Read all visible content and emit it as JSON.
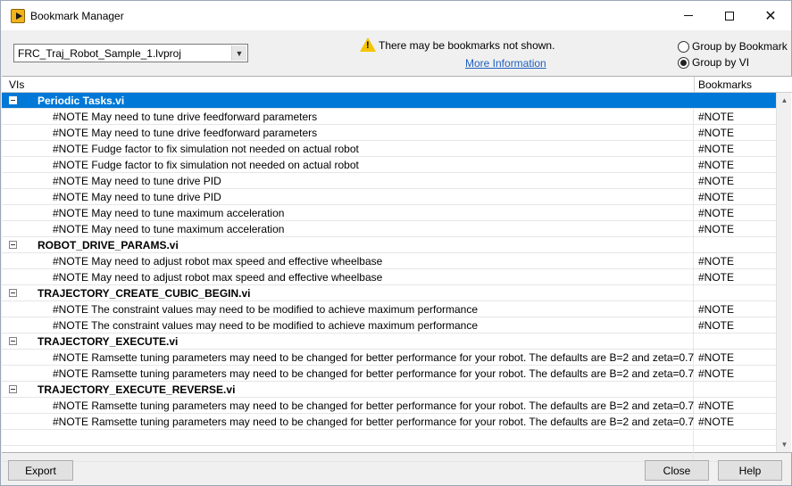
{
  "window": {
    "title": "Bookmark Manager",
    "minimize_label": "",
    "maximize_label": "",
    "close_label": "✕"
  },
  "toolbar": {
    "project": "FRC_Traj_Robot_Sample_1.lvproj",
    "dropdown_arrow": "▼",
    "warning_text": "There may be bookmarks not shown.",
    "more_info": "More Information",
    "group_by_bookmark": "Group by Bookmark",
    "group_by_vi": "Group by VI",
    "selected_grouping": "Group by VI"
  },
  "table": {
    "col_vis": "VIs",
    "col_bookmarks": "Bookmarks",
    "groups": [
      {
        "name": "Periodic Tasks.vi",
        "selected": true,
        "items": [
          {
            "text": "#NOTE  May need to tune drive feedforward parameters",
            "bookmark": "#NOTE"
          },
          {
            "text": "#NOTE  May need to tune drive feedforward parameters",
            "bookmark": "#NOTE"
          },
          {
            "text": "#NOTE Fudge factor to fix simulation not needed on actual robot",
            "bookmark": "#NOTE"
          },
          {
            "text": "#NOTE Fudge factor to fix simulation not needed on actual robot",
            "bookmark": "#NOTE"
          },
          {
            "text": "#NOTE May need to tune drive PID",
            "bookmark": "#NOTE"
          },
          {
            "text": "#NOTE May need to tune drive PID",
            "bookmark": "#NOTE"
          },
          {
            "text": "#NOTE May need to tune maximum acceleration",
            "bookmark": "#NOTE"
          },
          {
            "text": "#NOTE May need to tune maximum acceleration",
            "bookmark": "#NOTE"
          }
        ]
      },
      {
        "name": "ROBOT_DRIVE_PARAMS.vi",
        "selected": false,
        "items": [
          {
            "text": "#NOTE  May need to adjust robot max speed and effective wheelbase",
            "bookmark": "#NOTE"
          },
          {
            "text": "#NOTE  May need to adjust robot max speed and effective wheelbase",
            "bookmark": "#NOTE"
          }
        ]
      },
      {
        "name": "TRAJECTORY_CREATE_CUBIC_BEGIN.vi",
        "selected": false,
        "items": [
          {
            "text": "#NOTE  The constraint values may need to be modified to achieve maximum performance",
            "bookmark": "#NOTE"
          },
          {
            "text": "#NOTE  The constraint values may need to be modified to achieve maximum performance",
            "bookmark": "#NOTE"
          }
        ]
      },
      {
        "name": "TRAJECTORY_EXECUTE.vi",
        "selected": false,
        "items": [
          {
            "text": "#NOTE Ramsette tuning parameters may need to be changed for better performance for your robot. The defaults are B=2 and zeta=0.7",
            "bookmark": "#NOTE"
          },
          {
            "text": "#NOTE Ramsette tuning parameters may need to be changed for better performance for your robot. The defaults are B=2 and zeta=0.7",
            "bookmark": "#NOTE"
          }
        ]
      },
      {
        "name": "TRAJECTORY_EXECUTE_REVERSE.vi",
        "selected": false,
        "items": [
          {
            "text": "#NOTE Ramsette tuning parameters may need to be changed for better performance for your robot.  The defaults are B=2 and zeta=0.7",
            "bookmark": "#NOTE"
          },
          {
            "text": "#NOTE Ramsette tuning parameters may need to be changed for better performance for your robot.  The defaults are B=2 and zeta=0.7",
            "bookmark": "#NOTE"
          }
        ]
      }
    ]
  },
  "scrollbar": {
    "up_arrow": "▲",
    "down_arrow": "▼"
  },
  "buttons": {
    "export": "Export",
    "close": "Close",
    "help": "Help"
  },
  "colors": {
    "selection": "#0078d7",
    "link": "#1f5fbf",
    "warning": "#f5c400"
  }
}
